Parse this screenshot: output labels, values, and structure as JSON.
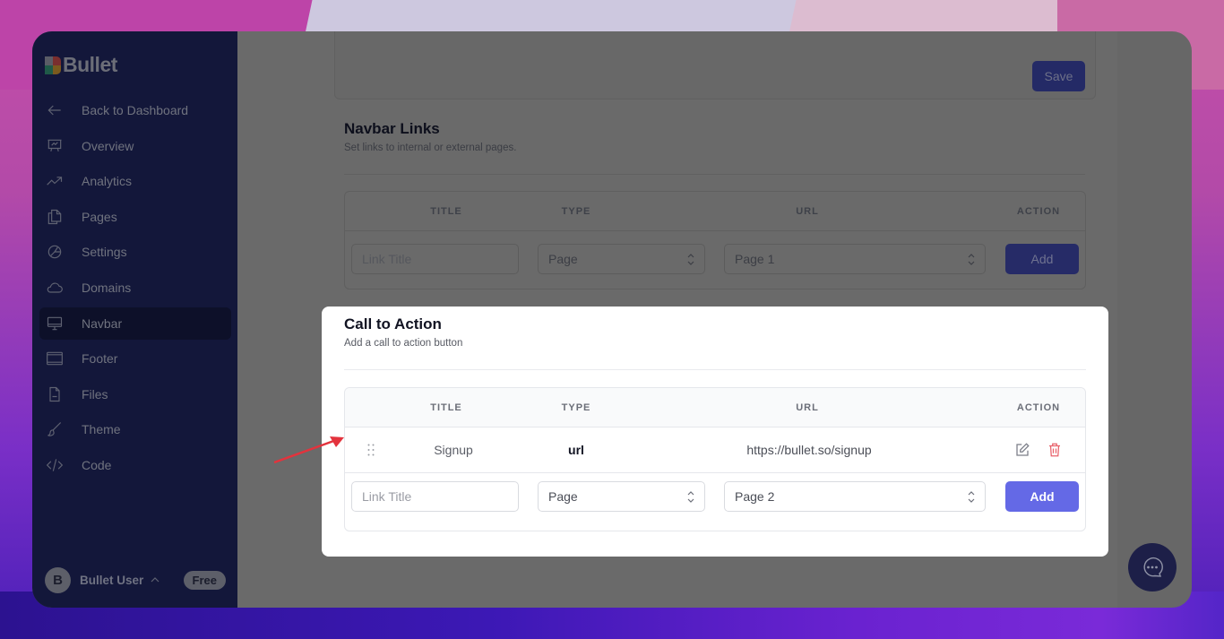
{
  "app": {
    "brand": "Bullet"
  },
  "sidebar": {
    "items": [
      {
        "label": "Back to Dashboard",
        "icon": "arrow-left-icon"
      },
      {
        "label": "Overview",
        "icon": "presentation-chart-icon"
      },
      {
        "label": "Analytics",
        "icon": "trending-up-icon"
      },
      {
        "label": "Pages",
        "icon": "documents-icon"
      },
      {
        "label": "Settings",
        "icon": "gear-icon"
      },
      {
        "label": "Domains",
        "icon": "cloud-icon"
      },
      {
        "label": "Navbar",
        "icon": "desktop-icon",
        "active": true
      },
      {
        "label": "Footer",
        "icon": "window-icon"
      },
      {
        "label": "Files",
        "icon": "file-icon"
      },
      {
        "label": "Theme",
        "icon": "brush-icon"
      },
      {
        "label": "Code",
        "icon": "code-icon"
      }
    ],
    "user": {
      "initial": "B",
      "name": "Bullet User",
      "plan": "Free"
    }
  },
  "top_card": {
    "save_label": "Save"
  },
  "navbar_links": {
    "title": "Navbar Links",
    "subtitle": "Set links to internal or external pages.",
    "columns": [
      "TITLE",
      "TYPE",
      "URL",
      "ACTION"
    ],
    "form": {
      "title_placeholder": "Link Title",
      "type_value": "Page",
      "url_value": "Page 1",
      "add_label": "Add"
    }
  },
  "call_to_action": {
    "title": "Call to Action",
    "subtitle": "Add a call to action button",
    "columns": [
      "TITLE",
      "TYPE",
      "URL",
      "ACTION"
    ],
    "rows": [
      {
        "title": "Signup",
        "type": "url",
        "url": "https://bullet.so/signup"
      }
    ],
    "form": {
      "title_placeholder": "Link Title",
      "type_value": "Page",
      "url_value": "Page 2",
      "add_label": "Add"
    }
  },
  "colors": {
    "sidebar_bg": "#13173a",
    "primary": "#6469e6",
    "delete": "#e8626b",
    "overlay": "#676767"
  }
}
